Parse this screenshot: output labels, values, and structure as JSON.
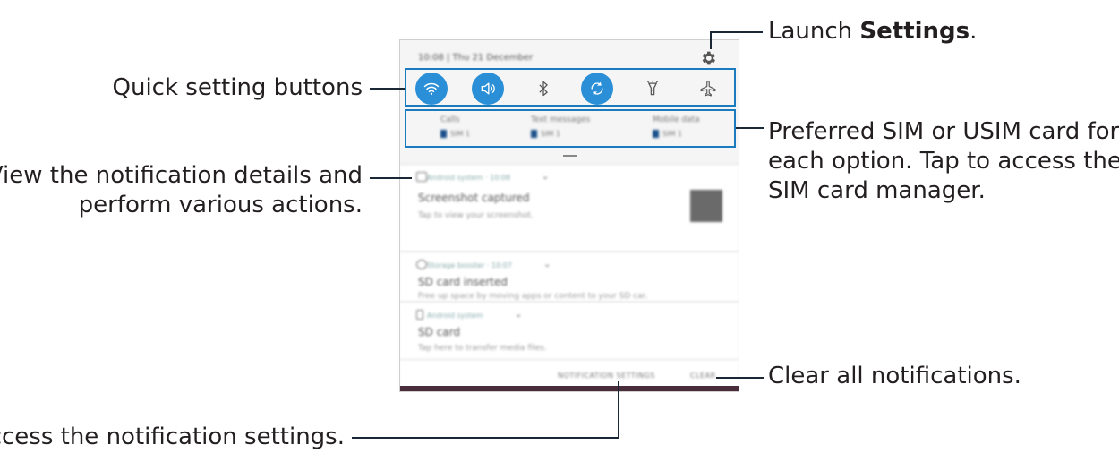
{
  "callouts": {
    "launch_settings_prefix": "Launch ",
    "launch_settings_bold": "Settings",
    "launch_settings_suffix": ".",
    "quick_setting_buttons": "Quick setting buttons",
    "preferred_sim_line1": "Preferred SIM or USIM card for",
    "preferred_sim_line2": "each option. Tap to access the",
    "preferred_sim_line3": "SIM card manager.",
    "view_details_line1": "View the notification details and",
    "view_details_line2": "perform various actions.",
    "clear_all": "Clear all notifications.",
    "access_settings": "Access the notification settings."
  },
  "phone": {
    "status_time": "10:08 | Thu 21 December",
    "quick_settings": [
      {
        "name": "wifi",
        "icon": "wifi-icon",
        "active": true
      },
      {
        "name": "sound",
        "icon": "sound-icon",
        "active": true
      },
      {
        "name": "bluetooth",
        "icon": "bluetooth-icon",
        "active": false
      },
      {
        "name": "auto-rotate",
        "icon": "rotate-icon",
        "active": true
      },
      {
        "name": "flashlight",
        "icon": "flashlight-icon",
        "active": false
      },
      {
        "name": "airplane",
        "icon": "airplane-icon",
        "active": false
      }
    ],
    "sim_prefs": [
      {
        "label": "Calls",
        "sim": "SIM 1"
      },
      {
        "label": "Text messages",
        "sim": "SIM 1"
      },
      {
        "label": "Mobile data",
        "sim": "SIM 1"
      }
    ],
    "notifications": [
      {
        "app": "Android system · 10:08",
        "title": "Screenshot captured",
        "text": "Tap to view your screenshot."
      },
      {
        "app": "Storage booster · 10:07",
        "title": "SD card inserted",
        "text": "Free up space by moving apps or content to your SD car."
      },
      {
        "app": "Android system",
        "title": "SD card",
        "text": "Tap here to transfer media files."
      }
    ],
    "footer": {
      "notification_settings": "NOTIFICATION SETTINGS",
      "clear": "CLEAR"
    }
  },
  "colors": {
    "accent": "#2a8fd6",
    "frame": "#1a7bbf",
    "line": "#1a2735"
  }
}
